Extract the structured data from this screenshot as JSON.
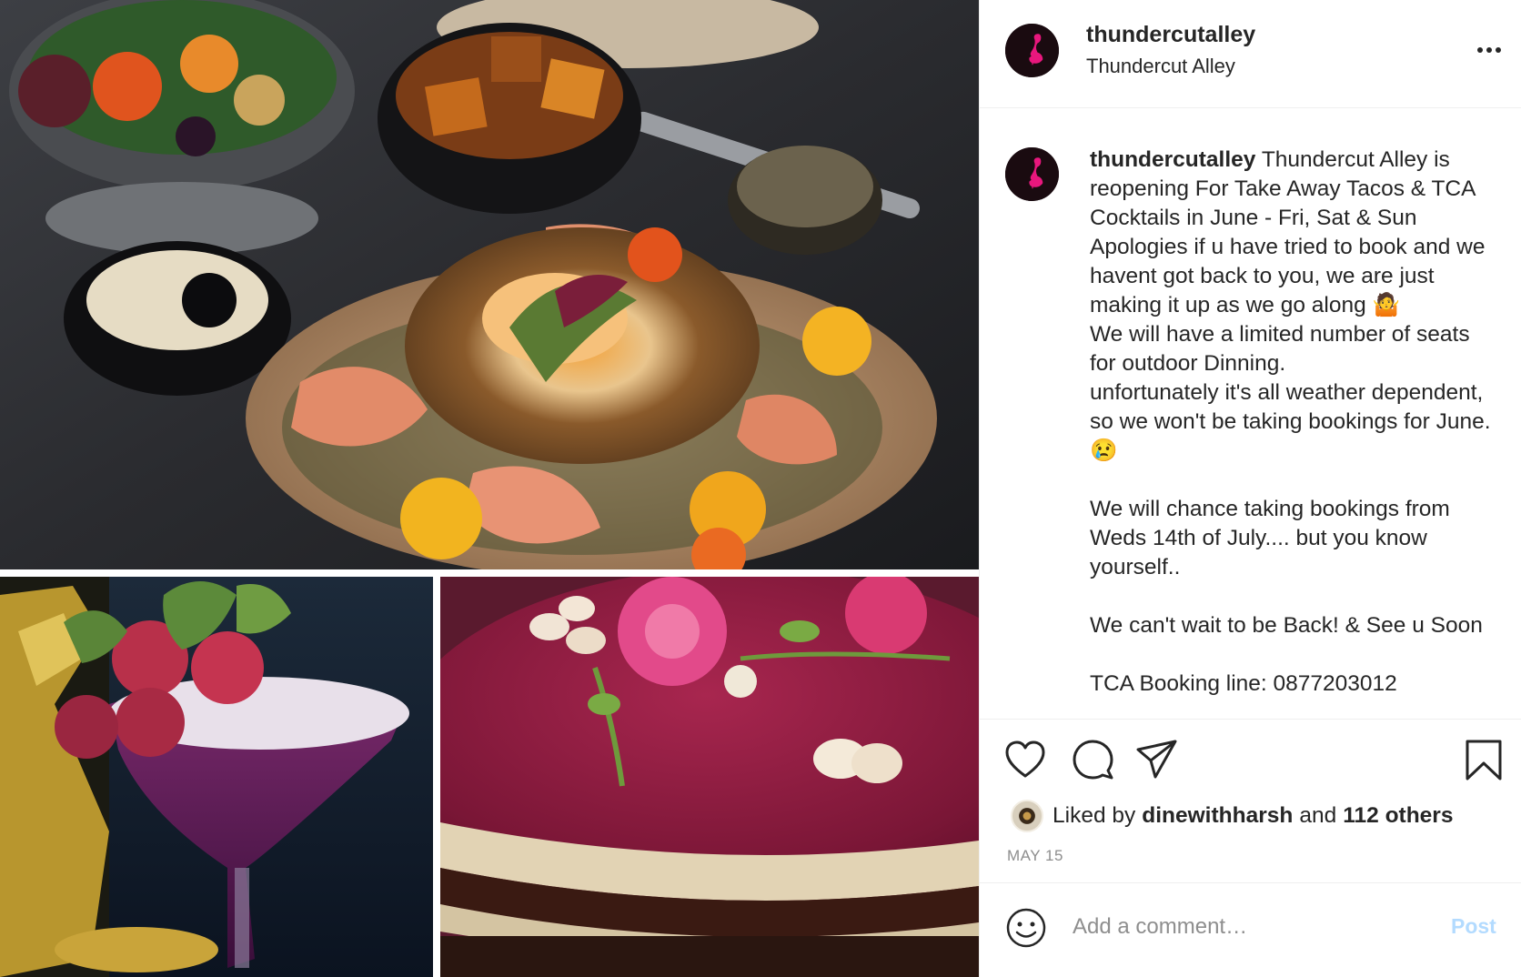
{
  "header": {
    "username": "thundercutalley",
    "location": "Thundercut Alley",
    "more_label": "•••"
  },
  "caption": {
    "username": "thundercutalley",
    "lines": [
      "Thundercut Alley is reopening For Take Away Tacos & TCA Cocktails in June - Fri, Sat & Sun",
      "Apologies if u have tried to book and we havent got back to you, we are just making it up as we go along 🤷",
      "We will have a limited number of seats for outdoor Dinning.",
      "unfortunately it's all weather dependent, so we won't be taking bookings for June. 😢",
      "",
      "We will chance taking bookings from Weds 14th of July.... but you know yourself..",
      "",
      "We can't wait to be Back! & See u Soon",
      "",
      "TCA Booking line: 0877203012"
    ]
  },
  "likes": {
    "prefix": "Liked by",
    "user": "dinewithharsh",
    "connector": "and",
    "others": "112 others"
  },
  "date": "MAY 15",
  "comment": {
    "placeholder": "Add a comment…",
    "post_label": "Post"
  },
  "colors": {
    "avatar_bg": "#1a0b10",
    "flamingo": "#e8177d",
    "post_button_disabled": "#b3dbff",
    "muted_text": "#8e8e8e"
  },
  "icons": {
    "like": "heart-icon",
    "comment": "speech-bubble-icon",
    "share": "paper-plane-icon",
    "save": "bookmark-icon",
    "emoji": "smiley-icon",
    "more": "ellipsis-icon"
  }
}
